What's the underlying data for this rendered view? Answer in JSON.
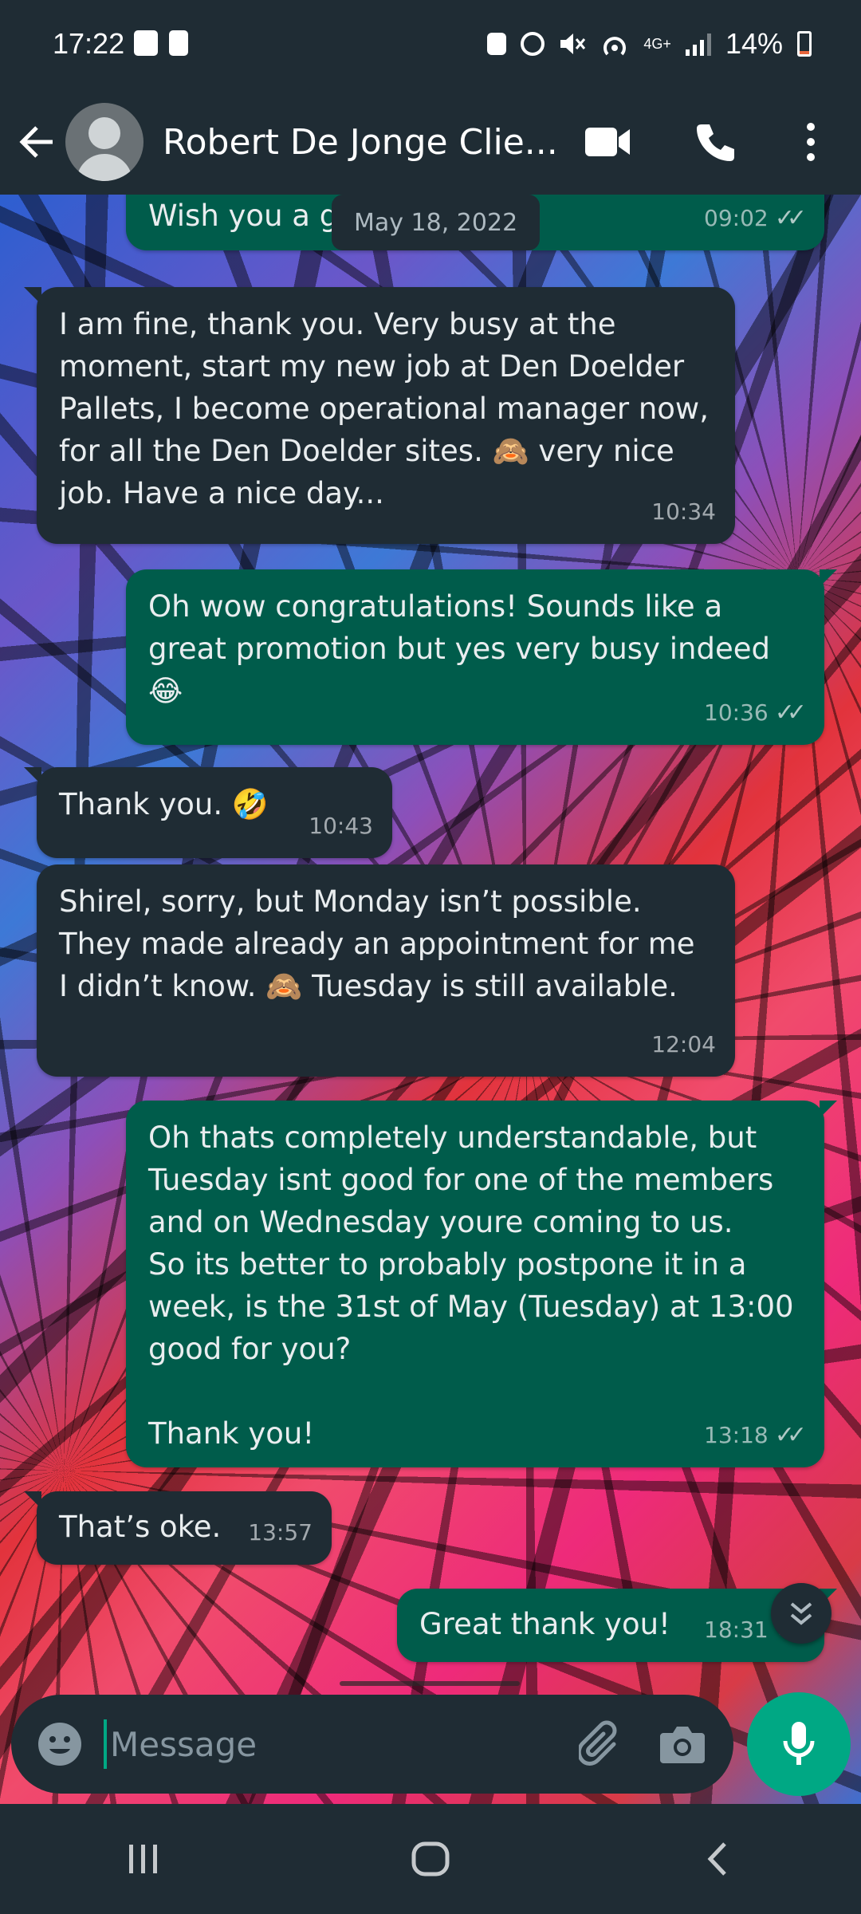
{
  "status_bar": {
    "time": "17:22",
    "network_label": "4G+",
    "battery_percent": "14%",
    "battery_level": 0.14,
    "icons": [
      "gallery-notification-icon",
      "alert-notification-icon",
      "data-saver-icon",
      "alarm-icon",
      "mute-icon",
      "hotspot-icon",
      "signal-icon",
      "battery-icon"
    ]
  },
  "header": {
    "contact_name": "Robert De Jonge Clie...",
    "icons": [
      "back-arrow-icon",
      "avatar",
      "video-call-icon",
      "phone-call-icon",
      "more-vertical-icon"
    ]
  },
  "date_chip": "May 18, 2022",
  "messages": [
    {
      "direction": "out",
      "text": "Wish you a g",
      "time": "09:02",
      "read": true
    },
    {
      "direction": "in",
      "text": "I am fine, thank you. Very busy at the moment, start my new job at Den Doelder Pallets, I become operational manager now, for all the Den Doelder sites. 🙈 very nice job. Have a nice day...",
      "time": "10:34"
    },
    {
      "direction": "out",
      "text": "Oh wow congratulations! Sounds like a great promotion but yes very busy indeed 😂",
      "time": "10:36",
      "read": true
    },
    {
      "direction": "in",
      "text": "Thank you. 🤣",
      "time": "10:43"
    },
    {
      "direction": "in",
      "text": "Shirel, sorry, but Monday isn’t possible. They made already an appointment for me I didn’t know. 🙈 Tuesday is still available.",
      "time": "12:04"
    },
    {
      "direction": "out",
      "text": "Oh thats completely understandable, but Tuesday isnt good for one of the members and on Wednesday youre coming to us.\nSo its better to probably postpone it in a week, is the 31st of May (Tuesday) at 13:00 good for you?\n\nThank you!",
      "time": "13:18",
      "read": true
    },
    {
      "direction": "in",
      "text": "That’s oke.",
      "time": "13:57"
    },
    {
      "direction": "out",
      "text": "Great thank you!",
      "time": "18:31",
      "read": true
    }
  ],
  "input": {
    "placeholder": "Message",
    "icons": [
      "emoji-icon",
      "attach-icon",
      "camera-icon",
      "mic-icon"
    ]
  },
  "nav_bar": {
    "icons": [
      "recents-icon",
      "home-icon",
      "back-icon"
    ]
  },
  "colors": {
    "bar_background": "#1f2c34",
    "incoming_bubble": "#1f2c34",
    "outgoing_bubble": "#005c4b",
    "accent_green": "#00a884",
    "battery_low": "#e8663d"
  }
}
